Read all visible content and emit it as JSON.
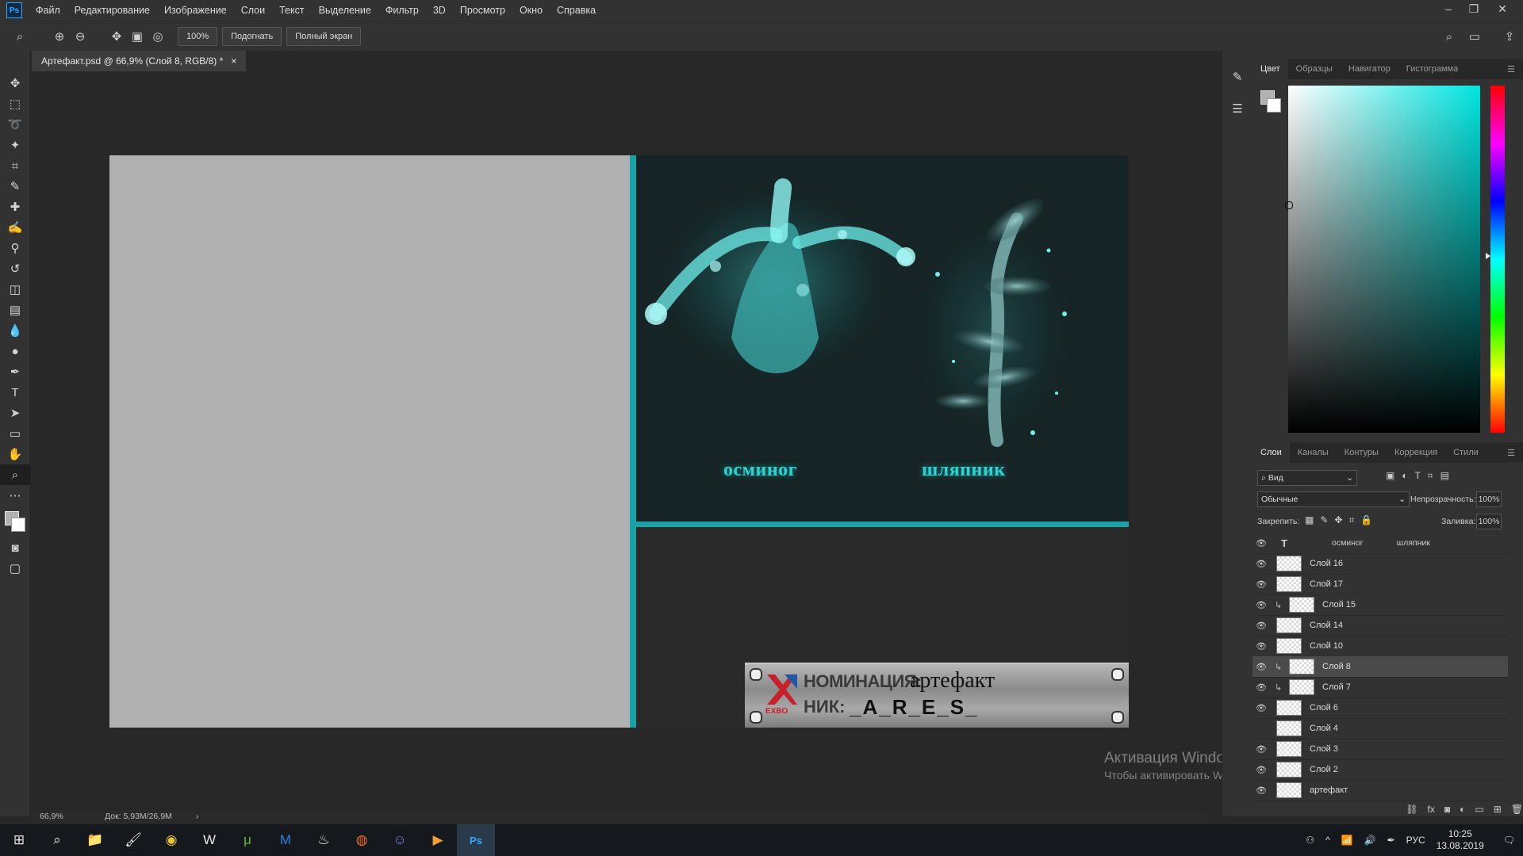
{
  "app": {
    "logo": "Ps",
    "accent": "#31a8ff"
  },
  "menu": [
    "Файл",
    "Редактирование",
    "Изображение",
    "Слои",
    "Текст",
    "Выделение",
    "Фильтр",
    "3D",
    "Просмотр",
    "Окно",
    "Справка"
  ],
  "window_controls": {
    "minimize": "–",
    "restore": "❐",
    "close": "✕"
  },
  "options_bar": {
    "zoom_value": "100%",
    "fit_label": "Подогнать",
    "fullscreen_label": "Полный экран"
  },
  "document": {
    "tab_title": "Артефакт.psd @ 66,9% (Слой 8, RGB/8) *",
    "close": "×"
  },
  "canvas": {
    "label_left": "осминог",
    "label_right": "шляпник",
    "plate_line1_prefix": "НОМИНАЦИЯ:",
    "plate_line1_value": "артефакт",
    "plate_line2_prefix": "НИК:",
    "plate_line2_value": "_A_R_E_S_",
    "plate_logo": "EXBO",
    "teal": "#1aa3a6",
    "text_teal": "#29d5d2"
  },
  "status_bar": {
    "zoom": "66,9%",
    "doc_size": "Док: 5,93M/26,9M",
    "arrow": "›"
  },
  "color_panel": {
    "tabs": [
      "Цвет",
      "Образцы",
      "Навигатор",
      "Гистограмма"
    ],
    "active": 0
  },
  "layers_panel": {
    "tabs": [
      "Слои",
      "Каналы",
      "Контуры",
      "Коррекция",
      "Стили"
    ],
    "active": 0,
    "filter_label": "Вид",
    "blend_mode": "Обычные",
    "opacity_label": "Непрозрачность:",
    "opacity_value": "100%",
    "lock_label": "Закрепить:",
    "fill_label": "Заливка:",
    "fill_value": "100%",
    "text_layer": {
      "type_glyph": "T",
      "name_a": "осминог",
      "name_b": "шляпник"
    },
    "layers": [
      {
        "name": "Слой 16",
        "visible": true,
        "clipped": false,
        "selected": false
      },
      {
        "name": "Слой 17",
        "visible": true,
        "clipped": false,
        "selected": false
      },
      {
        "name": "Слой 15",
        "visible": true,
        "clipped": true,
        "selected": false
      },
      {
        "name": "Слой 14",
        "visible": true,
        "clipped": false,
        "selected": false
      },
      {
        "name": "Слой 10",
        "visible": true,
        "clipped": false,
        "selected": false
      },
      {
        "name": "Слой 8",
        "visible": true,
        "clipped": true,
        "selected": true
      },
      {
        "name": "Слой 7",
        "visible": true,
        "clipped": true,
        "selected": false
      },
      {
        "name": "Слой 6",
        "visible": true,
        "clipped": false,
        "selected": false
      },
      {
        "name": "Слой 4",
        "visible": false,
        "clipped": false,
        "selected": false
      },
      {
        "name": "Слой 3",
        "visible": true,
        "clipped": false,
        "selected": false
      },
      {
        "name": "Слой 2",
        "visible": true,
        "clipped": false,
        "selected": false
      },
      {
        "name": "артефакт",
        "visible": true,
        "clipped": false,
        "selected": false
      }
    ]
  },
  "watermark": {
    "line1": "Активация Windows",
    "line2": "Чтобы активировать Windows, перейдите в раздел \"Параметры\"."
  },
  "taskbar": {
    "icons": [
      "windows-start-icon",
      "search-icon",
      "file-explorer-icon",
      "paint-icon",
      "chrome-icon",
      "wargaming-icon",
      "utorrent-icon",
      "malwarebytes-icon",
      "steam-icon",
      "origin-icon",
      "discord-icon",
      "media-player-icon",
      "photoshop-icon"
    ],
    "language": "РУС",
    "time": "10:25",
    "date": "13.08.2019"
  }
}
